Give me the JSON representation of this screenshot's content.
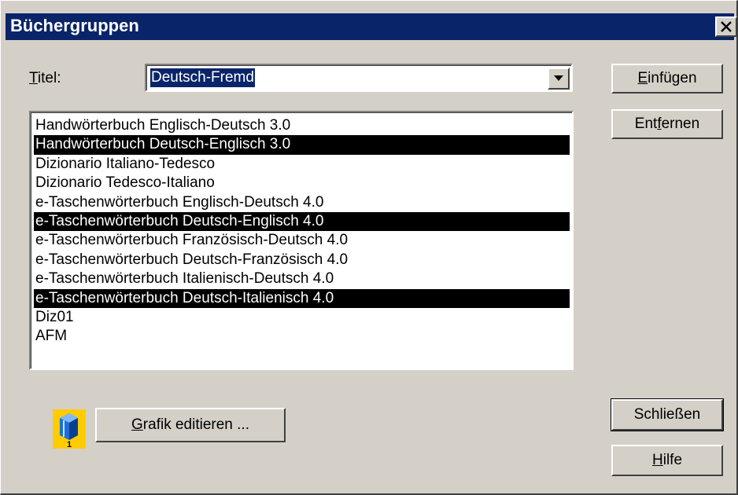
{
  "window": {
    "title": "Büchergruppen"
  },
  "titel": {
    "label_mnemonic": "T",
    "label_rest": "itel:",
    "value": "Deutsch-Fremd"
  },
  "list": {
    "items": [
      {
        "label": "Handwörterbuch Englisch-Deutsch 3.0",
        "selected": false
      },
      {
        "label": "Handwörterbuch Deutsch-Englisch 3.0",
        "selected": true
      },
      {
        "label": "Dizionario Italiano-Tedesco",
        "selected": false
      },
      {
        "label": "Dizionario Tedesco-Italiano",
        "selected": false
      },
      {
        "label": "e-Taschenwörterbuch Englisch-Deutsch 4.0",
        "selected": false
      },
      {
        "label": "e-Taschenwörterbuch Deutsch-Englisch 4.0",
        "selected": true
      },
      {
        "label": "e-Taschenwörterbuch Französisch-Deutsch 4.0",
        "selected": false
      },
      {
        "label": "e-Taschenwörterbuch Deutsch-Französisch 4.0",
        "selected": false
      },
      {
        "label": "e-Taschenwörterbuch Italienisch-Deutsch 4.0",
        "selected": false
      },
      {
        "label": "e-Taschenwörterbuch Deutsch-Italienisch 4.0",
        "selected": true
      },
      {
        "label": "Diz01",
        "selected": false
      },
      {
        "label": "AFM",
        "selected": false
      }
    ]
  },
  "buttons": {
    "einfuegen": {
      "pre": "",
      "mnemonic": "E",
      "post": "infügen"
    },
    "entfernen": {
      "pre": "Ent",
      "mnemonic": "f",
      "post": "ernen"
    },
    "grafik": {
      "pre": "",
      "mnemonic": "G",
      "post": "rafik editieren ..."
    },
    "schliessen": {
      "label": "Schließen"
    },
    "hilfe": {
      "pre": "",
      "mnemonic": "H",
      "post": "ilfe"
    }
  },
  "icon": {
    "name": "book-icon",
    "number": "1"
  },
  "colors": {
    "titlebar": "#0a246a",
    "face": "#d4d0c8",
    "selection": "#000000",
    "icon_bg": "#ffcc00"
  }
}
